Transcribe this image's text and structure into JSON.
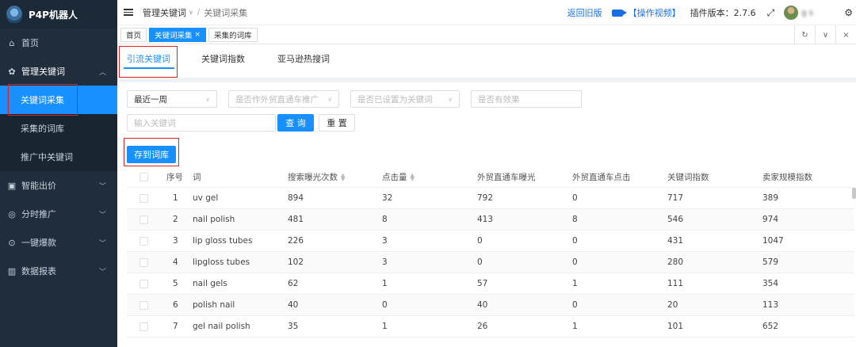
{
  "app": {
    "logo_text": "P4P机器人"
  },
  "sidebar": {
    "items": [
      {
        "icon": "home-icon",
        "label": "首页"
      },
      {
        "icon": "gear-icon",
        "label": "管理关键词",
        "open": true,
        "children": [
          {
            "label": "关键词采集",
            "active": true
          },
          {
            "label": "采集的词库"
          },
          {
            "label": "推广中关键词"
          }
        ]
      },
      {
        "icon": "chip-icon",
        "label": "智能出价"
      },
      {
        "icon": "clock-icon",
        "label": "分时推广"
      },
      {
        "icon": "rocket-icon",
        "label": "一键爆款"
      },
      {
        "icon": "chart-icon",
        "label": "数据报表"
      }
    ]
  },
  "header": {
    "breadcrumb": [
      "管理关键词",
      "关键词采集"
    ],
    "old_version": "返回旧版",
    "video_link": "【操作视频】",
    "plugin_version": "插件版本：2.7.6",
    "username": "g      s"
  },
  "tags": [
    {
      "label": "首页"
    },
    {
      "label": "关键词采集",
      "active": true,
      "close": "×"
    },
    {
      "label": "采集的词库"
    }
  ],
  "tabs": [
    "引流关键词",
    "关键词指数",
    "亚马逊热搜词"
  ],
  "filters": {
    "period": "最近一周",
    "promo_placeholder": "是否作外贸直通车推广",
    "set_kw_placeholder": "是否已设置为关键词",
    "effect_placeholder": "是否有效果",
    "keyword_placeholder": "输入关键词",
    "search_label": "查 询",
    "reset_label": "重 置",
    "save_label": "存到词库"
  },
  "table": {
    "headers": [
      "序号",
      "词",
      "搜索曝光次数",
      "点击量",
      "外贸直通车曝光",
      "外贸直通车点击",
      "关键词指数",
      "卖家规模指数"
    ],
    "rows": [
      [
        "1",
        "uv gel",
        "894",
        "32",
        "792",
        "0",
        "717",
        "389"
      ],
      [
        "2",
        "nail polish",
        "481",
        "8",
        "413",
        "8",
        "546",
        "974"
      ],
      [
        "3",
        "lip gloss tubes",
        "226",
        "3",
        "0",
        "0",
        "431",
        "1047"
      ],
      [
        "4",
        "lipgloss tubes",
        "102",
        "3",
        "0",
        "0",
        "280",
        "579"
      ],
      [
        "5",
        "nail gels",
        "62",
        "1",
        "57",
        "1",
        "111",
        "354"
      ],
      [
        "6",
        "polish nail",
        "40",
        "0",
        "40",
        "0",
        "20",
        "113"
      ],
      [
        "7",
        "gel nail polish",
        "35",
        "1",
        "26",
        "1",
        "101",
        "652"
      ]
    ]
  }
}
